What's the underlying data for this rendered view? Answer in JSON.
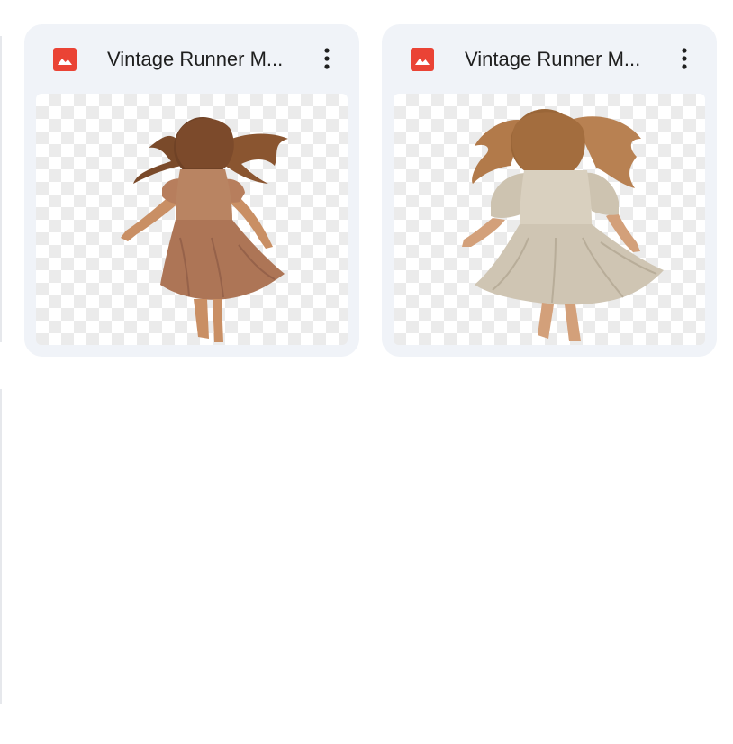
{
  "files": [
    {
      "name": "Vintage Runner M...",
      "icon": "image-file-icon",
      "menu_icon": "more-vert-icon",
      "preview": "girl-running-brown-dress"
    },
    {
      "name": "Vintage Runner M...",
      "icon": "image-file-icon",
      "menu_icon": "more-vert-icon",
      "preview": "girl-running-cream-dress"
    }
  ],
  "colors": {
    "card_bg": "#f0f3f8",
    "icon_red": "#ea4335",
    "title_text": "#1f1f1f"
  }
}
